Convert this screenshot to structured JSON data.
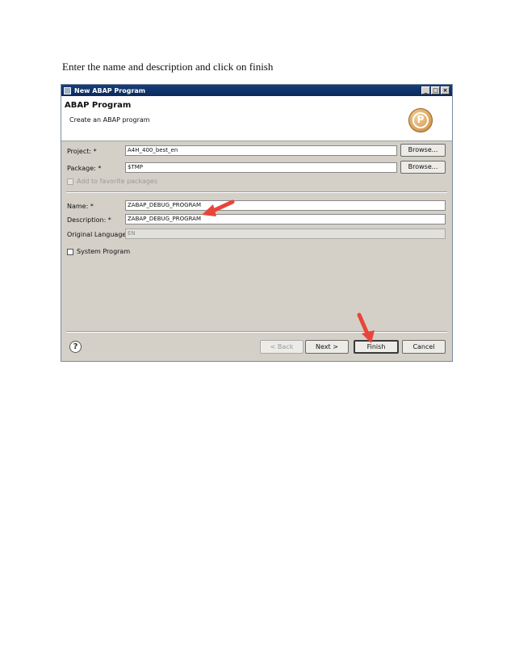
{
  "caption": "Enter the name and description and click on finish",
  "window": {
    "title": "New ABAP Program"
  },
  "header": {
    "title": "ABAP Program",
    "subtitle": "Create an ABAP program",
    "badge_letter": "P"
  },
  "form": {
    "project": {
      "label": "Project: *",
      "value": "A4H_400_best_en",
      "browse": "Browse..."
    },
    "package": {
      "label": "Package: *",
      "value": "$TMP",
      "browse": "Browse..."
    },
    "favorite": {
      "label": "Add to favorite packages"
    },
    "name": {
      "label": "Name: *",
      "value": "ZABAP_DEBUG_PROGRAM"
    },
    "description": {
      "label": "Description: *",
      "value": "ZABAP_DEBUG_PROGRAM"
    },
    "language": {
      "label": "Original Language:",
      "value": "EN"
    },
    "system_program": {
      "label": "System Program"
    }
  },
  "footer": {
    "back": "< Back",
    "next": "Next >",
    "finish": "Finish",
    "cancel": "Cancel",
    "help": "?"
  },
  "colors": {
    "titlebar": "#0b2a5c",
    "dialog_bg": "#d4d0c8",
    "arrow": "#e8453c"
  },
  "icons": [
    "app-icon",
    "minimize-icon",
    "maximize-icon",
    "close-icon",
    "program-p-icon",
    "help-icon",
    "pointer-arrow-icon"
  ]
}
